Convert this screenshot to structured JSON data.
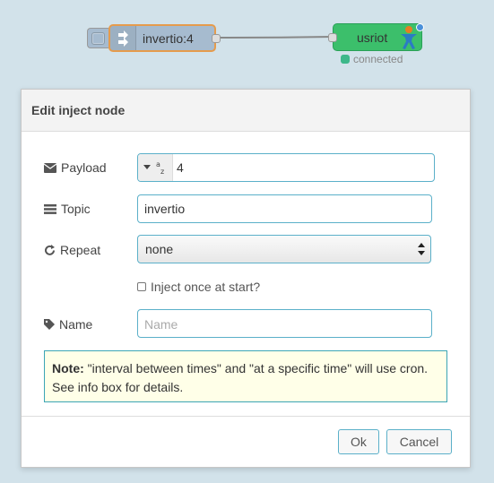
{
  "canvas": {
    "inject_node_label": "invertio:4",
    "output_node_label": "usriot",
    "status_text": "connected",
    "colors": {
      "inject_node": "#a6bbcf",
      "selected_border": "#e59b4d",
      "output_node": "#3cbf6b",
      "status_dot": "#3db88a"
    }
  },
  "dialog": {
    "title": "Edit inject node",
    "payload": {
      "label": "Payload",
      "type_icon": "az-string-icon",
      "value": "4"
    },
    "topic": {
      "label": "Topic",
      "value": "invertio"
    },
    "repeat": {
      "label": "Repeat",
      "selected": "none"
    },
    "inject_once": {
      "label": "Inject once at start?",
      "checked": false
    },
    "name": {
      "label": "Name",
      "placeholder": "Name",
      "value": ""
    },
    "note": {
      "bold": "Note:",
      "text": " \"interval between times\" and \"at a specific time\" will use cron. See info box for details."
    },
    "buttons": {
      "ok": "Ok",
      "cancel": "Cancel"
    }
  }
}
